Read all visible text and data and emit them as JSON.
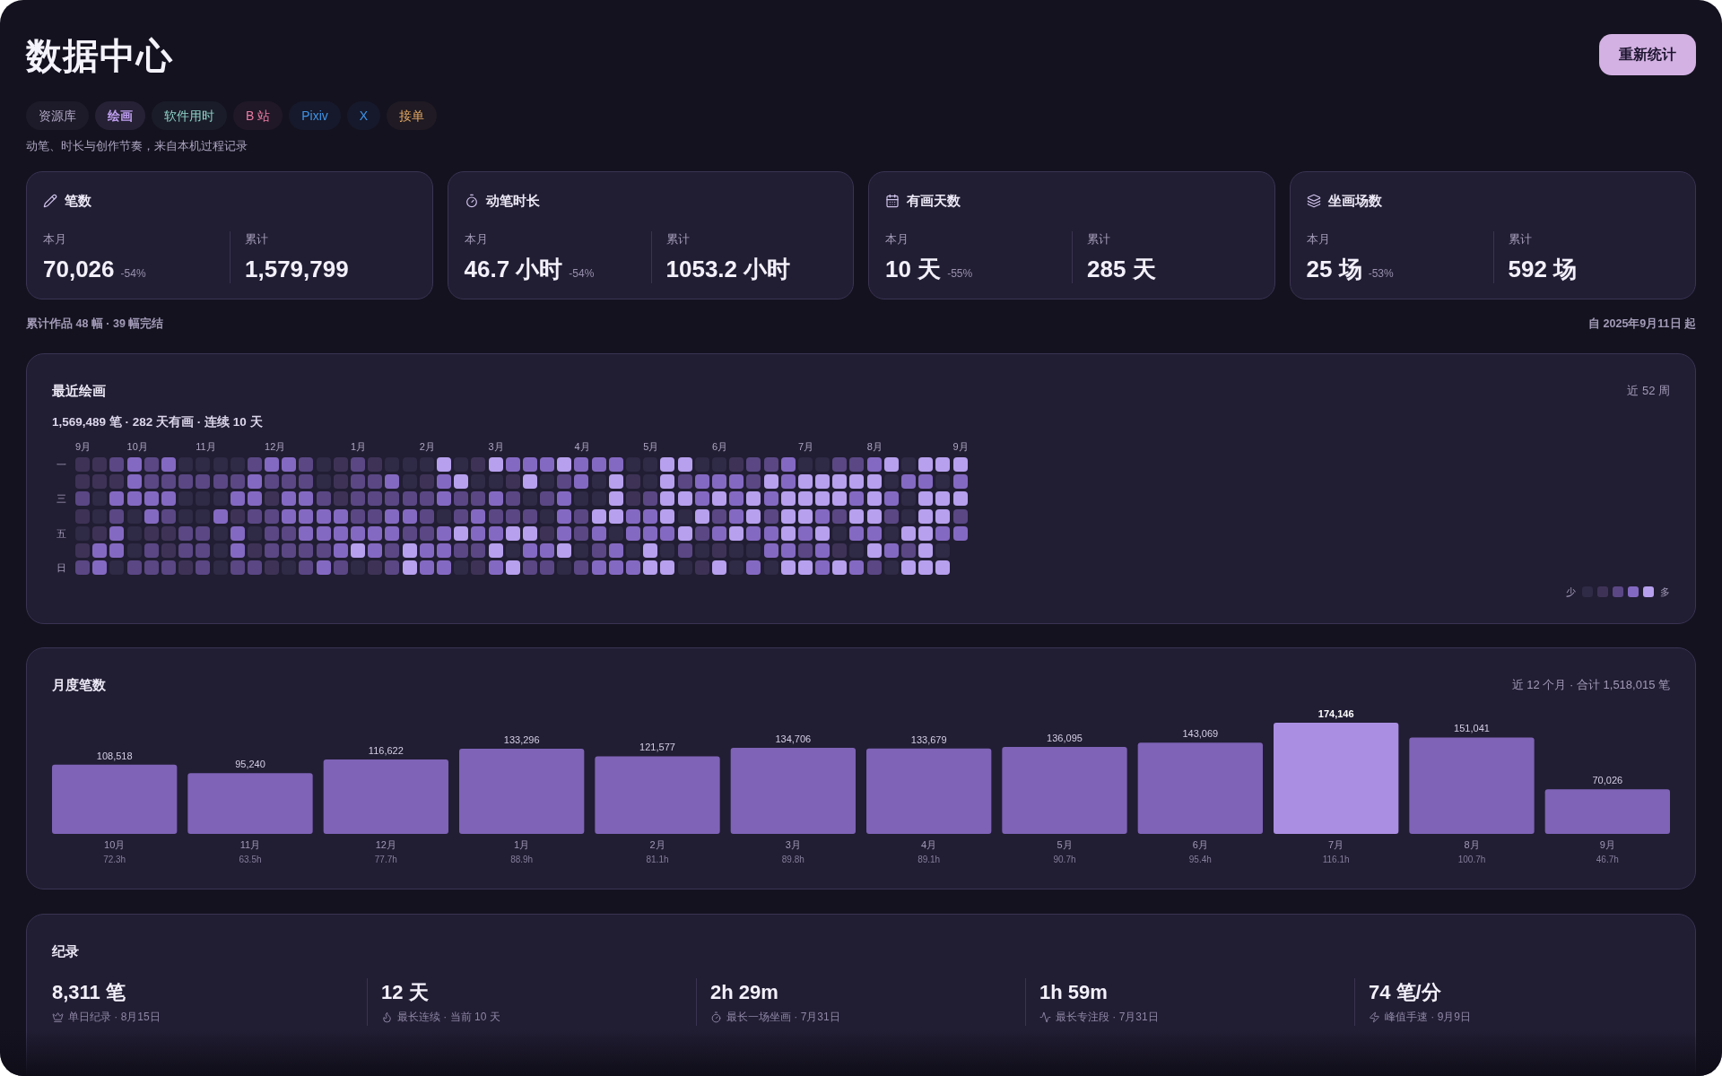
{
  "header": {
    "title": "数据中心",
    "button": "重新统计"
  },
  "tabs": [
    {
      "label": "资源库",
      "color": "#b3aac8",
      "selected": false
    },
    {
      "label": "绘画",
      "color": "#bf9ff0",
      "selected": true
    },
    {
      "label": "软件用时",
      "color": "#8fd3c9",
      "selected": false
    },
    {
      "label": "B 站",
      "color": "#ec7ba3",
      "selected": false
    },
    {
      "label": "Pixiv",
      "color": "#3f94e6",
      "selected": false
    },
    {
      "label": "X",
      "color": "#3f94e6",
      "selected": false
    },
    {
      "label": "接单",
      "color": "#e3a862",
      "selected": false
    }
  ],
  "subtitle": "动笔、时长与创作节奏，来自本机过程记录",
  "stats": [
    {
      "title": "笔数",
      "month_label": "本月",
      "month_value": "70,026",
      "change": "-54%",
      "total_label": "累计",
      "total_value": "1,579,799"
    },
    {
      "title": "动笔时长",
      "month_label": "本月",
      "month_value": "46.7 小时",
      "change": "-54%",
      "total_label": "累计",
      "total_value": "1053.2 小时"
    },
    {
      "title": "有画天数",
      "month_label": "本月",
      "month_value": "10 天",
      "change": "-55%",
      "total_label": "累计",
      "total_value": "285 天"
    },
    {
      "title": "坐画场数",
      "month_label": "本月",
      "month_value": "25 场",
      "change": "-53%",
      "total_label": "累计",
      "total_value": "592 场"
    }
  ],
  "footer": {
    "works": "累计作品 48 幅 · 39 幅完结",
    "since": "自 2025年9月11日 起"
  },
  "heatmap": {
    "title": "最近绘画",
    "summary": "1,569,489 笔 · 282 天有画 · 连续 10 天",
    "range": "近 52 周",
    "day_labels": [
      "一",
      "三",
      "五",
      "日"
    ],
    "weeks": [
      {
        "month": "9月",
        "days": [
          {
            "color": "#3e3356"
          },
          {
            "color": "#3e3356"
          },
          {
            "color": "#5a4784"
          },
          {
            "color": "#3e3356"
          },
          {
            "color": "#2f2a45"
          },
          {
            "color": "#3e3356"
          },
          {
            "color": "#5a4784"
          }
        ]
      },
      {
        "days": [
          {
            "color": "#3e3356"
          },
          {
            "color": "#3e3356"
          },
          {
            "color": "#2f2a45"
          },
          {
            "color": "#2f2a45"
          },
          {
            "color": "#3e3356"
          },
          {
            "color": "#8469c2"
          },
          {
            "color": "#8469c2"
          }
        ]
      },
      {
        "days": [
          {
            "color": "#5a4784"
          },
          {
            "color": "#3e3356"
          },
          {
            "color": "#8469c2"
          },
          {
            "color": "#5a4784"
          },
          {
            "color": "#8469c2"
          },
          {
            "color": "#8469c2"
          },
          {
            "color": "#2f2a45"
          }
        ]
      },
      {
        "month": "10月",
        "days": [
          {
            "color": "#8469c2"
          },
          {
            "color": "#8469c2"
          },
          {
            "color": "#8469c2"
          },
          {
            "color": "#2f2a45"
          },
          {
            "color": "#2f2a45"
          },
          {
            "color": "#2f2a45"
          },
          {
            "color": "#5a4784"
          }
        ]
      },
      {
        "days": [
          {
            "color": "#5a4784"
          },
          {
            "color": "#5a4784"
          },
          {
            "color": "#8469c2"
          },
          {
            "color": "#8469c2"
          },
          {
            "color": "#3e3356"
          },
          {
            "color": "#5a4784"
          },
          {
            "color": "#5a4784"
          }
        ]
      },
      {
        "days": [
          {
            "color": "#8469c2"
          },
          {
            "color": "#5a4784"
          },
          {
            "color": "#8469c2"
          },
          {
            "color": "#5a4784"
          },
          {
            "color": "#3e3356"
          },
          {
            "color": "#3e3356"
          },
          {
            "color": "#5a4784"
          }
        ]
      },
      {
        "days": [
          {
            "color": "#2f2a45"
          },
          {
            "color": "#5a4784"
          },
          {
            "color": "#2f2a45"
          },
          {
            "color": "#2f2a45"
          },
          {
            "color": "#5a4784"
          },
          {
            "color": "#5a4784"
          },
          {
            "color": "#3e3356"
          }
        ]
      },
      {
        "month": "11月",
        "days": [
          {
            "color": "#2f2a45"
          },
          {
            "color": "#5a4784"
          },
          {
            "color": "#2f2a45"
          },
          {
            "color": "#2f2a45"
          },
          {
            "color": "#5a4784"
          },
          {
            "color": "#5a4784"
          },
          {
            "color": "#5a4784"
          }
        ]
      },
      {
        "days": [
          {
            "color": "#2f2a45"
          },
          {
            "color": "#5a4784"
          },
          {
            "color": "#2f2a45"
          },
          {
            "color": "#8469c2"
          },
          {
            "color": "#2f2a45"
          },
          {
            "color": "#2f2a45"
          },
          {
            "color": "#2f2a45"
          }
        ]
      },
      {
        "days": [
          {
            "color": "#2f2a45"
          },
          {
            "color": "#5a4784"
          },
          {
            "color": "#8469c2"
          },
          {
            "color": "#3e3356"
          },
          {
            "color": "#8469c2"
          },
          {
            "color": "#8469c2"
          },
          {
            "color": "#5a4784"
          }
        ]
      },
      {
        "days": [
          {
            "color": "#5a4784"
          },
          {
            "color": "#8469c2"
          },
          {
            "color": "#8469c2"
          },
          {
            "color": "#5a4784"
          },
          {
            "color": "#2f2a45"
          },
          {
            "color": "#3e3356"
          },
          {
            "color": "#5a4784"
          }
        ]
      },
      {
        "month": "12月",
        "days": [
          {
            "color": "#8469c2"
          },
          {
            "color": "#5a4784"
          },
          {
            "color": "#3e3356"
          },
          {
            "color": "#5a4784"
          },
          {
            "color": "#5a4784"
          },
          {
            "color": "#5a4784"
          },
          {
            "color": "#3e3356"
          }
        ]
      },
      {
        "days": [
          {
            "color": "#8469c2"
          },
          {
            "color": "#5a4784"
          },
          {
            "color": "#8469c2"
          },
          {
            "color": "#8469c2"
          },
          {
            "color": "#5a4784"
          },
          {
            "color": "#5a4784"
          },
          {
            "color": "#2f2a45"
          }
        ]
      },
      {
        "days": [
          {
            "color": "#5a4784"
          },
          {
            "color": "#5a4784"
          },
          {
            "color": "#8469c2"
          },
          {
            "color": "#8469c2"
          },
          {
            "color": "#8469c2"
          },
          {
            "color": "#5a4784"
          },
          {
            "color": "#5a4784"
          }
        ]
      },
      {
        "days": [
          {
            "color": "#2f2a45"
          },
          {
            "color": "#2f2a45"
          },
          {
            "color": "#5a4784"
          },
          {
            "color": "#8469c2"
          },
          {
            "color": "#8469c2"
          },
          {
            "color": "#5a4784"
          },
          {
            "color": "#8469c2"
          }
        ]
      },
      {
        "days": [
          {
            "color": "#3e3356"
          },
          {
            "color": "#3e3356"
          },
          {
            "color": "#3e3356"
          },
          {
            "color": "#8469c2"
          },
          {
            "color": "#8469c2"
          },
          {
            "color": "#8469c2"
          },
          {
            "color": "#5a4784"
          }
        ]
      },
      {
        "month": "1月",
        "days": [
          {
            "color": "#5a4784"
          },
          {
            "color": "#5a4784"
          },
          {
            "color": "#5a4784"
          },
          {
            "color": "#5a4784"
          },
          {
            "color": "#8469c2"
          },
          {
            "color": "#b7a0ee"
          },
          {
            "color": "#2f2a45"
          }
        ]
      },
      {
        "days": [
          {
            "color": "#3e3356"
          },
          {
            "color": "#5a4784"
          },
          {
            "color": "#5a4784"
          },
          {
            "color": "#5a4784"
          },
          {
            "color": "#8469c2"
          },
          {
            "color": "#8469c2"
          },
          {
            "color": "#3e3356"
          }
        ]
      },
      {
        "days": [
          {
            "color": "#2f2a45"
          },
          {
            "color": "#8469c2"
          },
          {
            "color": "#5a4784"
          },
          {
            "color": "#8469c2"
          },
          {
            "color": "#8469c2"
          },
          {
            "color": "#5a4784"
          },
          {
            "color": "#5a4784"
          }
        ]
      },
      {
        "days": [
          {
            "color": "#2f2a45"
          },
          {
            "color": "#2f2a45"
          },
          {
            "color": "#5a4784"
          },
          {
            "color": "#8469c2"
          },
          {
            "color": "#5a4784"
          },
          {
            "color": "#b7a0ee"
          },
          {
            "color": "#b7a0ee"
          }
        ]
      },
      {
        "month": "2月",
        "days": [
          {
            "color": "#2f2a45"
          },
          {
            "color": "#3e3356"
          },
          {
            "color": "#5a4784"
          },
          {
            "color": "#5a4784"
          },
          {
            "color": "#5a4784"
          },
          {
            "color": "#8469c2"
          },
          {
            "color": "#8469c2"
          }
        ]
      },
      {
        "days": [
          {
            "color": "#b7a0ee"
          },
          {
            "color": "#8469c2"
          },
          {
            "color": "#8469c2"
          },
          {
            "color": "#2f2a45"
          },
          {
            "color": "#8469c2"
          },
          {
            "color": "#8469c2"
          },
          {
            "color": "#8469c2"
          }
        ]
      },
      {
        "days": [
          {
            "color": "#2f2a45"
          },
          {
            "color": "#b7a0ee"
          },
          {
            "color": "#5a4784"
          },
          {
            "color": "#5a4784"
          },
          {
            "color": "#b7a0ee"
          },
          {
            "color": "#5a4784"
          },
          {
            "color": "#2f2a45"
          }
        ]
      },
      {
        "days": [
          {
            "color": "#3e3356"
          },
          {
            "color": "#2f2a45"
          },
          {
            "color": "#5a4784"
          },
          {
            "color": "#8469c2"
          },
          {
            "color": "#8469c2"
          },
          {
            "color": "#5a4784"
          },
          {
            "color": "#3e3356"
          }
        ]
      },
      {
        "month": "3月",
        "days": [
          {
            "color": "#b7a0ee"
          },
          {
            "color": "#2f2a45"
          },
          {
            "color": "#8469c2"
          },
          {
            "color": "#5a4784"
          },
          {
            "color": "#8469c2"
          },
          {
            "color": "#b7a0ee"
          },
          {
            "color": "#8469c2"
          }
        ]
      },
      {
        "days": [
          {
            "color": "#8469c2"
          },
          {
            "color": "#3e3356"
          },
          {
            "color": "#5a4784"
          },
          {
            "color": "#5a4784"
          },
          {
            "color": "#b7a0ee"
          },
          {
            "color": "#2f2a45"
          },
          {
            "color": "#b7a0ee"
          }
        ]
      },
      {
        "days": [
          {
            "color": "#8469c2"
          },
          {
            "color": "#b7a0ee"
          },
          {
            "color": "#2f2a45"
          },
          {
            "color": "#5a4784"
          },
          {
            "color": "#b7a0ee"
          },
          {
            "color": "#8469c2"
          },
          {
            "color": "#5a4784"
          }
        ]
      },
      {
        "days": [
          {
            "color": "#8469c2"
          },
          {
            "color": "#2f2a45"
          },
          {
            "color": "#5a4784"
          },
          {
            "color": "#2f2a45"
          },
          {
            "color": "#3e3356"
          },
          {
            "color": "#8469c2"
          },
          {
            "color": "#5a4784"
          }
        ]
      },
      {
        "days": [
          {
            "color": "#b7a0ee"
          },
          {
            "color": "#5a4784"
          },
          {
            "color": "#8469c2"
          },
          {
            "color": "#8469c2"
          },
          {
            "color": "#8469c2"
          },
          {
            "color": "#b7a0ee"
          },
          {
            "color": "#2f2a45"
          }
        ]
      },
      {
        "month": "4月",
        "days": [
          {
            "color": "#8469c2"
          },
          {
            "color": "#8469c2"
          },
          {
            "color": "#2f2a45"
          },
          {
            "color": "#5a4784"
          },
          {
            "color": "#5a4784"
          },
          {
            "color": "#2f2a45"
          },
          {
            "color": "#5a4784"
          }
        ]
      },
      {
        "days": [
          {
            "color": "#8469c2"
          },
          {
            "color": "#2f2a45"
          },
          {
            "color": "#2f2a45"
          },
          {
            "color": "#b7a0ee"
          },
          {
            "color": "#8469c2"
          },
          {
            "color": "#5a4784"
          },
          {
            "color": "#8469c2"
          }
        ]
      },
      {
        "days": [
          {
            "color": "#8469c2"
          },
          {
            "color": "#b7a0ee"
          },
          {
            "color": "#b7a0ee"
          },
          {
            "color": "#b7a0ee"
          },
          {
            "color": "#2f2a45"
          },
          {
            "color": "#8469c2"
          },
          {
            "color": "#8469c2"
          }
        ]
      },
      {
        "days": [
          {
            "color": "#2f2a45"
          },
          {
            "color": "#3e3356"
          },
          {
            "color": "#3e3356"
          },
          {
            "color": "#8469c2"
          },
          {
            "color": "#8469c2"
          },
          {
            "color": "#2f2a45"
          },
          {
            "color": "#8469c2"
          }
        ]
      },
      {
        "month": "5月",
        "days": [
          {
            "color": "#2f2a45"
          },
          {
            "color": "#2f2a45"
          },
          {
            "color": "#5a4784"
          },
          {
            "color": "#8469c2"
          },
          {
            "color": "#8469c2"
          },
          {
            "color": "#b7a0ee"
          },
          {
            "color": "#b7a0ee"
          }
        ]
      },
      {
        "days": [
          {
            "color": "#b7a0ee"
          },
          {
            "color": "#b7a0ee"
          },
          {
            "color": "#b7a0ee"
          },
          {
            "color": "#b7a0ee"
          },
          {
            "color": "#8469c2"
          },
          {
            "color": "#2f2a45"
          },
          {
            "color": "#b7a0ee"
          }
        ]
      },
      {
        "days": [
          {
            "color": "#b7a0ee"
          },
          {
            "color": "#5a4784"
          },
          {
            "color": "#b7a0ee"
          },
          {
            "color": "#2f2a45"
          },
          {
            "color": "#b7a0ee"
          },
          {
            "color": "#5a4784"
          },
          {
            "color": "#2f2a45"
          }
        ]
      },
      {
        "days": [
          {
            "color": "#2f2a45"
          },
          {
            "color": "#8469c2"
          },
          {
            "color": "#8469c2"
          },
          {
            "color": "#b7a0ee"
          },
          {
            "color": "#5a4784"
          },
          {
            "color": "#2f2a45"
          },
          {
            "color": "#3e3356"
          }
        ]
      },
      {
        "month": "6月",
        "days": [
          {
            "color": "#2f2a45"
          },
          {
            "color": "#8469c2"
          },
          {
            "color": "#b7a0ee"
          },
          {
            "color": "#5a4784"
          },
          {
            "color": "#8469c2"
          },
          {
            "color": "#3e3356"
          },
          {
            "color": "#b7a0ee"
          }
        ]
      },
      {
        "days": [
          {
            "color": "#3e3356"
          },
          {
            "color": "#8469c2"
          },
          {
            "color": "#8469c2"
          },
          {
            "color": "#8469c2"
          },
          {
            "color": "#b7a0ee"
          },
          {
            "color": "#2f2a45"
          },
          {
            "color": "#2f2a45"
          }
        ]
      },
      {
        "days": [
          {
            "color": "#5a4784"
          },
          {
            "color": "#5a4784"
          },
          {
            "color": "#b7a0ee"
          },
          {
            "color": "#b7a0ee"
          },
          {
            "color": "#8469c2"
          },
          {
            "color": "#2f2a45"
          },
          {
            "color": "#8469c2"
          }
        ]
      },
      {
        "days": [
          {
            "color": "#5a4784"
          },
          {
            "color": "#b7a0ee"
          },
          {
            "color": "#8469c2"
          },
          {
            "color": "#5a4784"
          },
          {
            "color": "#8469c2"
          },
          {
            "color": "#8469c2"
          },
          {
            "color": "#2f2a45"
          }
        ]
      },
      {
        "days": [
          {
            "color": "#8469c2"
          },
          {
            "color": "#8469c2"
          },
          {
            "color": "#b7a0ee"
          },
          {
            "color": "#b7a0ee"
          },
          {
            "color": "#b7a0ee"
          },
          {
            "color": "#8469c2"
          },
          {
            "color": "#b7a0ee"
          }
        ]
      },
      {
        "month": "7月",
        "days": [
          {
            "color": "#2f2a45"
          },
          {
            "color": "#b7a0ee"
          },
          {
            "color": "#b7a0ee"
          },
          {
            "color": "#b7a0ee"
          },
          {
            "color": "#8469c2"
          },
          {
            "color": "#5a4784"
          },
          {
            "color": "#b7a0ee"
          }
        ]
      },
      {
        "days": [
          {
            "color": "#2f2a45"
          },
          {
            "color": "#b7a0ee"
          },
          {
            "color": "#b7a0ee"
          },
          {
            "color": "#8469c2"
          },
          {
            "color": "#b7a0ee"
          },
          {
            "color": "#8469c2"
          },
          {
            "color": "#8469c2"
          }
        ]
      },
      {
        "days": [
          {
            "color": "#5a4784"
          },
          {
            "color": "#b7a0ee"
          },
          {
            "color": "#b7a0ee"
          },
          {
            "color": "#5a4784"
          },
          {
            "color": "#2f2a45"
          },
          {
            "color": "#3e3356"
          },
          {
            "color": "#b7a0ee"
          }
        ]
      },
      {
        "days": [
          {
            "color": "#5a4784"
          },
          {
            "color": "#b7a0ee"
          },
          {
            "color": "#8469c2"
          },
          {
            "color": "#b7a0ee"
          },
          {
            "color": "#8469c2"
          },
          {
            "color": "#2f2a45"
          },
          {
            "color": "#8469c2"
          }
        ]
      },
      {
        "month": "8月",
        "days": [
          {
            "color": "#8469c2"
          },
          {
            "color": "#b7a0ee"
          },
          {
            "color": "#b7a0ee"
          },
          {
            "color": "#b7a0ee"
          },
          {
            "color": "#8469c2"
          },
          {
            "color": "#b7a0ee"
          },
          {
            "color": "#5a4784"
          }
        ]
      },
      {
        "days": [
          {
            "color": "#b7a0ee"
          },
          {
            "color": "#2f2a45"
          },
          {
            "color": "#8469c2"
          },
          {
            "color": "#5a4784"
          },
          {
            "color": "#2f2a45"
          },
          {
            "color": "#8469c2"
          },
          {
            "color": "#2f2a45"
          }
        ]
      },
      {
        "days": [
          {
            "color": "#2f2a45"
          },
          {
            "color": "#8469c2"
          },
          {
            "color": "#2f2a45"
          },
          {
            "color": "#2f2a45"
          },
          {
            "color": "#b7a0ee"
          },
          {
            "color": "#5a4784"
          },
          {
            "color": "#b7a0ee"
          }
        ]
      },
      {
        "days": [
          {
            "color": "#b7a0ee"
          },
          {
            "color": "#8469c2"
          },
          {
            "color": "#b7a0ee"
          },
          {
            "color": "#b7a0ee"
          },
          {
            "color": "#b7a0ee"
          },
          {
            "color": "#b7a0ee"
          },
          {
            "color": "#b7a0ee"
          }
        ]
      },
      {
        "days": [
          {
            "color": "#b7a0ee"
          },
          {
            "color": "#2f2a45"
          },
          {
            "color": "#b7a0ee"
          },
          {
            "color": "#b7a0ee"
          },
          {
            "color": "#8469c2"
          },
          {
            "color": "#2f2a45"
          },
          {
            "color": "#b7a0ee"
          }
        ]
      },
      {
        "month": "9月",
        "days": [
          {
            "color": "#b7a0ee"
          },
          {
            "color": "#8469c2"
          },
          {
            "color": "#b7a0ee"
          },
          {
            "color": "#5a4784"
          },
          {
            "color": "#8469c2"
          }
        ]
      }
    ],
    "legend": {
      "less": "少",
      "more": "多"
    }
  },
  "monthly": {
    "title": "月度笔数",
    "summary": "近 12 个月 · 合计 1,518,015 笔",
    "chart_data": {
      "type": "bar",
      "categories": [
        "10月",
        "11月",
        "12月",
        "1月",
        "2月",
        "3月",
        "4月",
        "5月",
        "6月",
        "7月",
        "8月",
        "9月"
      ],
      "values": [
        108518,
        95240,
        116622,
        133296,
        121577,
        134706,
        133679,
        136095,
        143069,
        174146,
        151041,
        70026
      ],
      "value_labels": [
        "108,518",
        "95,240",
        "116,622",
        "133,296",
        "121,577",
        "134,706",
        "133,679",
        "136,095",
        "143,069",
        "174,146",
        "151,041",
        "70,026"
      ]
    },
    "bars": [
      {
        "hours": "72.3h",
        "highlighted": false
      },
      {
        "hours": "63.5h",
        "highlighted": false
      },
      {
        "hours": "77.7h",
        "highlighted": false
      },
      {
        "hours": "88.9h",
        "highlighted": false
      },
      {
        "hours": "81.1h",
        "highlighted": false
      },
      {
        "hours": "89.8h",
        "highlighted": false
      },
      {
        "hours": "89.1h",
        "highlighted": false
      },
      {
        "hours": "90.7h",
        "highlighted": false
      },
      {
        "hours": "95.4h",
        "highlighted": false
      },
      {
        "hours": "116.1h",
        "highlighted": true
      },
      {
        "hours": "100.7h",
        "highlighted": false
      },
      {
        "hours": "46.7h",
        "highlighted": false
      }
    ]
  },
  "records": {
    "title": "纪录",
    "items": [
      {
        "value": "8,311 笔",
        "label": "单日纪录 · 8月15日"
      },
      {
        "value": "12 天",
        "label": "最长连续 · 当前 10 天"
      },
      {
        "value": "2h 29m",
        "label": "最长一场坐画 · 7月31日"
      },
      {
        "value": "1h 59m",
        "label": "最长专注段 · 7月31日"
      },
      {
        "value": "74 笔/分",
        "label": "峰值手速 · 9月9日"
      }
    ]
  }
}
